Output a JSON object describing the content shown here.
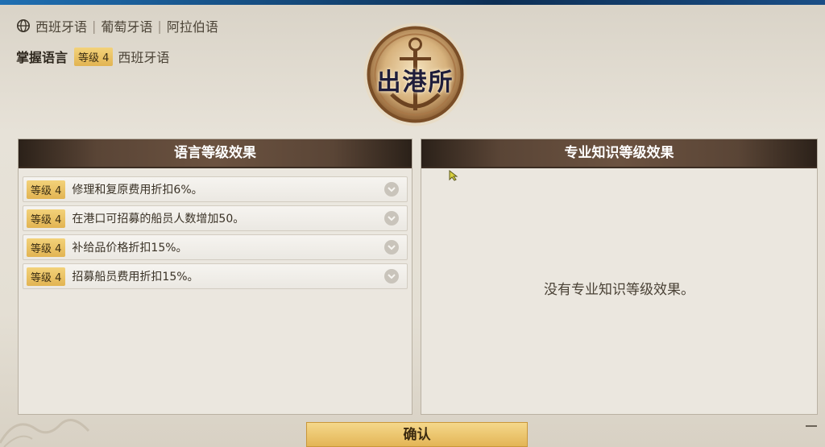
{
  "languages": {
    "items": [
      "西班牙语",
      "葡萄牙语",
      "阿拉伯语"
    ]
  },
  "mastery": {
    "title": "掌握语言",
    "level_label": "等级 4",
    "language": "西班牙语"
  },
  "emblem": {
    "title": "出港所"
  },
  "left_panel": {
    "title": "语言等级效果",
    "effects": [
      {
        "level": "等级 4",
        "text": "修理和复原费用折扣6%。"
      },
      {
        "level": "等级 4",
        "text": "在港口可招募的船员人数增加50。"
      },
      {
        "level": "等级 4",
        "text": "补给品价格折扣15%。"
      },
      {
        "level": "等级 4",
        "text": "招募船员费用折扣15%。"
      }
    ]
  },
  "right_panel": {
    "title": "专业知识等级效果",
    "empty_text": "没有专业知识等级效果。"
  },
  "buttons": {
    "confirm": "确认"
  },
  "icons": {
    "globe": "globe-icon",
    "chevron": "chevron-down-icon",
    "emblem": "anchor-emblem-icon"
  },
  "colors": {
    "level_badge": "#e2b452",
    "header": "#5a4536",
    "confirm": "#e3b556"
  }
}
